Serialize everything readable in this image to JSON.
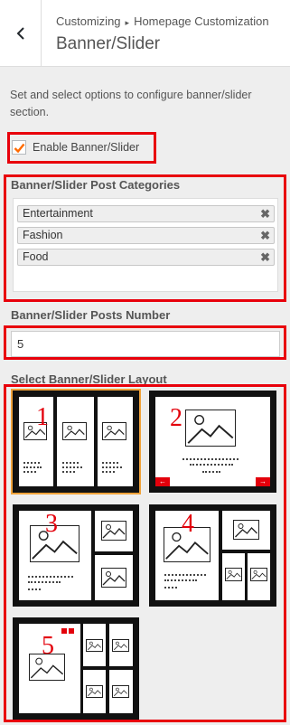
{
  "header": {
    "breadcrumb_root": "Customizing",
    "breadcrumb_separator": "▸",
    "breadcrumb_current": "Homepage Customization",
    "title": "Banner/Slider",
    "back_icon": "chevron-left-icon"
  },
  "description": "Set and select options to configure banner/slider section.",
  "enable": {
    "label": "Enable Banner/Slider",
    "checked": true,
    "check_color": "#ff6a00"
  },
  "categories": {
    "title": "Banner/Slider Post Categories",
    "items": [
      {
        "label": "Entertainment",
        "remove": "✖"
      },
      {
        "label": "Fashion",
        "remove": "✖"
      },
      {
        "label": "Food",
        "remove": "✖"
      }
    ]
  },
  "posts_number": {
    "title": "Banner/Slider Posts Number",
    "value": "5"
  },
  "layouts": {
    "title": "Select Banner/Slider Layout",
    "options": [
      {
        "number": "1",
        "selected": true
      },
      {
        "number": "2",
        "selected": false,
        "prev_arrow": "←",
        "next_arrow": "→"
      },
      {
        "number": "3",
        "selected": false
      },
      {
        "number": "4",
        "selected": false
      },
      {
        "number": "5",
        "selected": false
      }
    ]
  },
  "colors": {
    "highlight": "#e8000b",
    "accent_red": "#e3000b",
    "selected_outline": "#f0a23a"
  }
}
